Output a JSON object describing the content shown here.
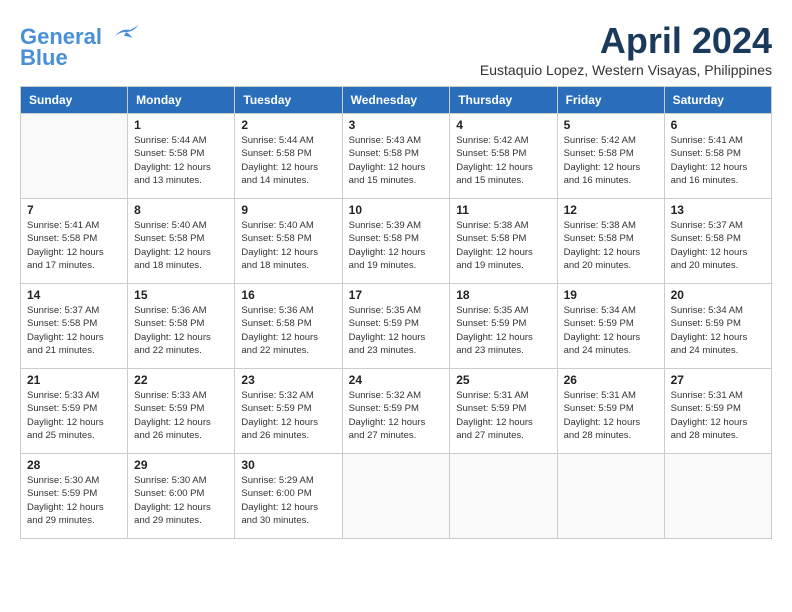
{
  "header": {
    "logo_line1": "General",
    "logo_line2": "Blue",
    "month": "April 2024",
    "location": "Eustaquio Lopez, Western Visayas, Philippines"
  },
  "weekdays": [
    "Sunday",
    "Monday",
    "Tuesday",
    "Wednesday",
    "Thursday",
    "Friday",
    "Saturday"
  ],
  "weeks": [
    [
      {
        "day": "",
        "info": ""
      },
      {
        "day": "1",
        "info": "Sunrise: 5:44 AM\nSunset: 5:58 PM\nDaylight: 12 hours\nand 13 minutes."
      },
      {
        "day": "2",
        "info": "Sunrise: 5:44 AM\nSunset: 5:58 PM\nDaylight: 12 hours\nand 14 minutes."
      },
      {
        "day": "3",
        "info": "Sunrise: 5:43 AM\nSunset: 5:58 PM\nDaylight: 12 hours\nand 15 minutes."
      },
      {
        "day": "4",
        "info": "Sunrise: 5:42 AM\nSunset: 5:58 PM\nDaylight: 12 hours\nand 15 minutes."
      },
      {
        "day": "5",
        "info": "Sunrise: 5:42 AM\nSunset: 5:58 PM\nDaylight: 12 hours\nand 16 minutes."
      },
      {
        "day": "6",
        "info": "Sunrise: 5:41 AM\nSunset: 5:58 PM\nDaylight: 12 hours\nand 16 minutes."
      }
    ],
    [
      {
        "day": "7",
        "info": "Sunrise: 5:41 AM\nSunset: 5:58 PM\nDaylight: 12 hours\nand 17 minutes."
      },
      {
        "day": "8",
        "info": "Sunrise: 5:40 AM\nSunset: 5:58 PM\nDaylight: 12 hours\nand 18 minutes."
      },
      {
        "day": "9",
        "info": "Sunrise: 5:40 AM\nSunset: 5:58 PM\nDaylight: 12 hours\nand 18 minutes."
      },
      {
        "day": "10",
        "info": "Sunrise: 5:39 AM\nSunset: 5:58 PM\nDaylight: 12 hours\nand 19 minutes."
      },
      {
        "day": "11",
        "info": "Sunrise: 5:38 AM\nSunset: 5:58 PM\nDaylight: 12 hours\nand 19 minutes."
      },
      {
        "day": "12",
        "info": "Sunrise: 5:38 AM\nSunset: 5:58 PM\nDaylight: 12 hours\nand 20 minutes."
      },
      {
        "day": "13",
        "info": "Sunrise: 5:37 AM\nSunset: 5:58 PM\nDaylight: 12 hours\nand 20 minutes."
      }
    ],
    [
      {
        "day": "14",
        "info": "Sunrise: 5:37 AM\nSunset: 5:58 PM\nDaylight: 12 hours\nand 21 minutes."
      },
      {
        "day": "15",
        "info": "Sunrise: 5:36 AM\nSunset: 5:58 PM\nDaylight: 12 hours\nand 22 minutes."
      },
      {
        "day": "16",
        "info": "Sunrise: 5:36 AM\nSunset: 5:58 PM\nDaylight: 12 hours\nand 22 minutes."
      },
      {
        "day": "17",
        "info": "Sunrise: 5:35 AM\nSunset: 5:59 PM\nDaylight: 12 hours\nand 23 minutes."
      },
      {
        "day": "18",
        "info": "Sunrise: 5:35 AM\nSunset: 5:59 PM\nDaylight: 12 hours\nand 23 minutes."
      },
      {
        "day": "19",
        "info": "Sunrise: 5:34 AM\nSunset: 5:59 PM\nDaylight: 12 hours\nand 24 minutes."
      },
      {
        "day": "20",
        "info": "Sunrise: 5:34 AM\nSunset: 5:59 PM\nDaylight: 12 hours\nand 24 minutes."
      }
    ],
    [
      {
        "day": "21",
        "info": "Sunrise: 5:33 AM\nSunset: 5:59 PM\nDaylight: 12 hours\nand 25 minutes."
      },
      {
        "day": "22",
        "info": "Sunrise: 5:33 AM\nSunset: 5:59 PM\nDaylight: 12 hours\nand 26 minutes."
      },
      {
        "day": "23",
        "info": "Sunrise: 5:32 AM\nSunset: 5:59 PM\nDaylight: 12 hours\nand 26 minutes."
      },
      {
        "day": "24",
        "info": "Sunrise: 5:32 AM\nSunset: 5:59 PM\nDaylight: 12 hours\nand 27 minutes."
      },
      {
        "day": "25",
        "info": "Sunrise: 5:31 AM\nSunset: 5:59 PM\nDaylight: 12 hours\nand 27 minutes."
      },
      {
        "day": "26",
        "info": "Sunrise: 5:31 AM\nSunset: 5:59 PM\nDaylight: 12 hours\nand 28 minutes."
      },
      {
        "day": "27",
        "info": "Sunrise: 5:31 AM\nSunset: 5:59 PM\nDaylight: 12 hours\nand 28 minutes."
      }
    ],
    [
      {
        "day": "28",
        "info": "Sunrise: 5:30 AM\nSunset: 5:59 PM\nDaylight: 12 hours\nand 29 minutes."
      },
      {
        "day": "29",
        "info": "Sunrise: 5:30 AM\nSunset: 6:00 PM\nDaylight: 12 hours\nand 29 minutes."
      },
      {
        "day": "30",
        "info": "Sunrise: 5:29 AM\nSunset: 6:00 PM\nDaylight: 12 hours\nand 30 minutes."
      },
      {
        "day": "",
        "info": ""
      },
      {
        "day": "",
        "info": ""
      },
      {
        "day": "",
        "info": ""
      },
      {
        "day": "",
        "info": ""
      }
    ]
  ]
}
